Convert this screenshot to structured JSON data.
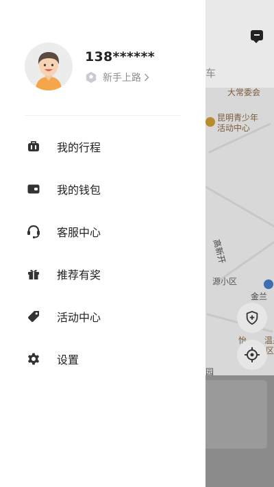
{
  "map": {
    "tab_partial": "车",
    "labels": [
      "大常委会",
      "昆明青少年",
      "活动中心",
      "高新开",
      "源小区",
      "金兰",
      "怡",
      "温泉",
      "区",
      "园"
    ]
  },
  "profile": {
    "phone": "138******",
    "level": "新手上路",
    "level_icon": "hexagon-badge-icon"
  },
  "menu": {
    "items": [
      {
        "label": "我的行程",
        "icon": "luggage-icon"
      },
      {
        "label": "我的钱包",
        "icon": "wallet-icon"
      },
      {
        "label": "客服中心",
        "icon": "headset-icon"
      },
      {
        "label": "推荐有奖",
        "icon": "gift-icon"
      },
      {
        "label": "活动中心",
        "icon": "tag-icon"
      },
      {
        "label": "设置",
        "icon": "gear-icon"
      }
    ]
  },
  "colors": {
    "drawer_bg": "#ffffff",
    "overlay": "#7a7a7a",
    "text_primary": "#222222",
    "text_secondary": "#8c8c8c",
    "icon": "#333333"
  }
}
